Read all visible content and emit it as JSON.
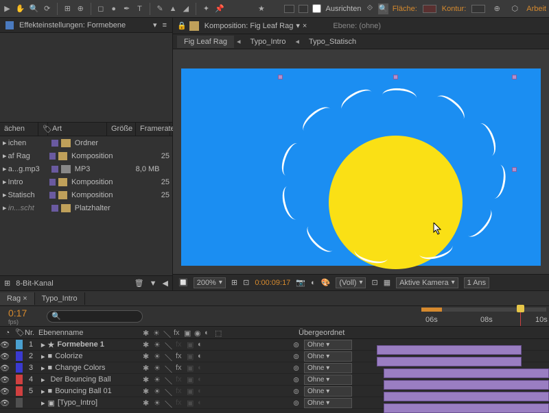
{
  "toolbar": {
    "align_label": "Ausrichten",
    "fill_label": "Fläche:",
    "stroke_label": "Kontur:",
    "work_label": "Arbeit"
  },
  "effects_panel": {
    "title": "Effekteinstellungen: Formebene"
  },
  "project": {
    "columns": {
      "c1": "ächen",
      "c2": "Art",
      "c3": "Größe",
      "c4": "Framerate"
    },
    "rows": [
      {
        "name": "ichen",
        "type": "Ordner",
        "size": "",
        "fr": "",
        "ic": "folder"
      },
      {
        "name": "af Rag",
        "type": "Komposition",
        "size": "",
        "fr": "25",
        "ic": "comp"
      },
      {
        "name": "a...g.mp3",
        "type": "MP3",
        "size": "8,0 MB",
        "fr": "",
        "ic": "mp3"
      },
      {
        "name": "Intro",
        "type": "Komposition",
        "size": "",
        "fr": "25",
        "ic": "comp"
      },
      {
        "name": "Statisch",
        "type": "Komposition",
        "size": "",
        "fr": "25",
        "ic": "comp"
      },
      {
        "name": "in...scht",
        "type": "Platzhalter",
        "size": "",
        "fr": "",
        "ic": "ph",
        "italic": true
      }
    ],
    "footer": {
      "bits": "8-Bit-Kanal"
    }
  },
  "viewer": {
    "comp_label": "Komposition: Fig Leaf Rag",
    "layer_label": "Ebene: (ohne)",
    "subtabs": [
      "Fig Leaf Rag",
      "Typo_Intro",
      "Typo_Statisch"
    ],
    "footer": {
      "zoom": "200%",
      "time": "0:00:09:17",
      "res": "(Voll)",
      "camera": "Aktive Kamera",
      "views": "1 Ans"
    }
  },
  "timeline": {
    "tabs": [
      "Rag ×",
      "Typo_Intro"
    ],
    "timecode": "0:17",
    "fps_hint": "fps)",
    "columns": {
      "nr": "Nr.",
      "name": "Ebenenname",
      "parent": "Übergeordnet"
    },
    "parent_none": "Ohne",
    "ruler": [
      "06s",
      "08s",
      "10s"
    ],
    "layers": [
      {
        "n": "1",
        "name": "Formebene 1",
        "color": "#4aa0d0",
        "icon": "star",
        "bold": true,
        "fx": false,
        "mode": true
      },
      {
        "n": "2",
        "name": "Colorize",
        "color": "#3a3ad0",
        "icon": "solid",
        "bold": false,
        "fx": true,
        "mode": true
      },
      {
        "n": "3",
        "name": "Change Colors",
        "color": "#3a3ad0",
        "icon": "solid",
        "bold": false,
        "fx": true,
        "mode": false
      },
      {
        "n": "4",
        "name": "Der Bouncing Ball",
        "color": "#d04040",
        "icon": "none",
        "bold": false,
        "fx": false,
        "mode": false
      },
      {
        "n": "5",
        "name": "Bouncing Ball 01",
        "color": "#d04040",
        "icon": "solid",
        "bold": false,
        "fx": false,
        "mode": false
      },
      {
        "n": "",
        "name": "[Typo_Intro]",
        "color": "#505050",
        "icon": "comp",
        "bold": false,
        "fx": false,
        "mode": false
      }
    ]
  }
}
